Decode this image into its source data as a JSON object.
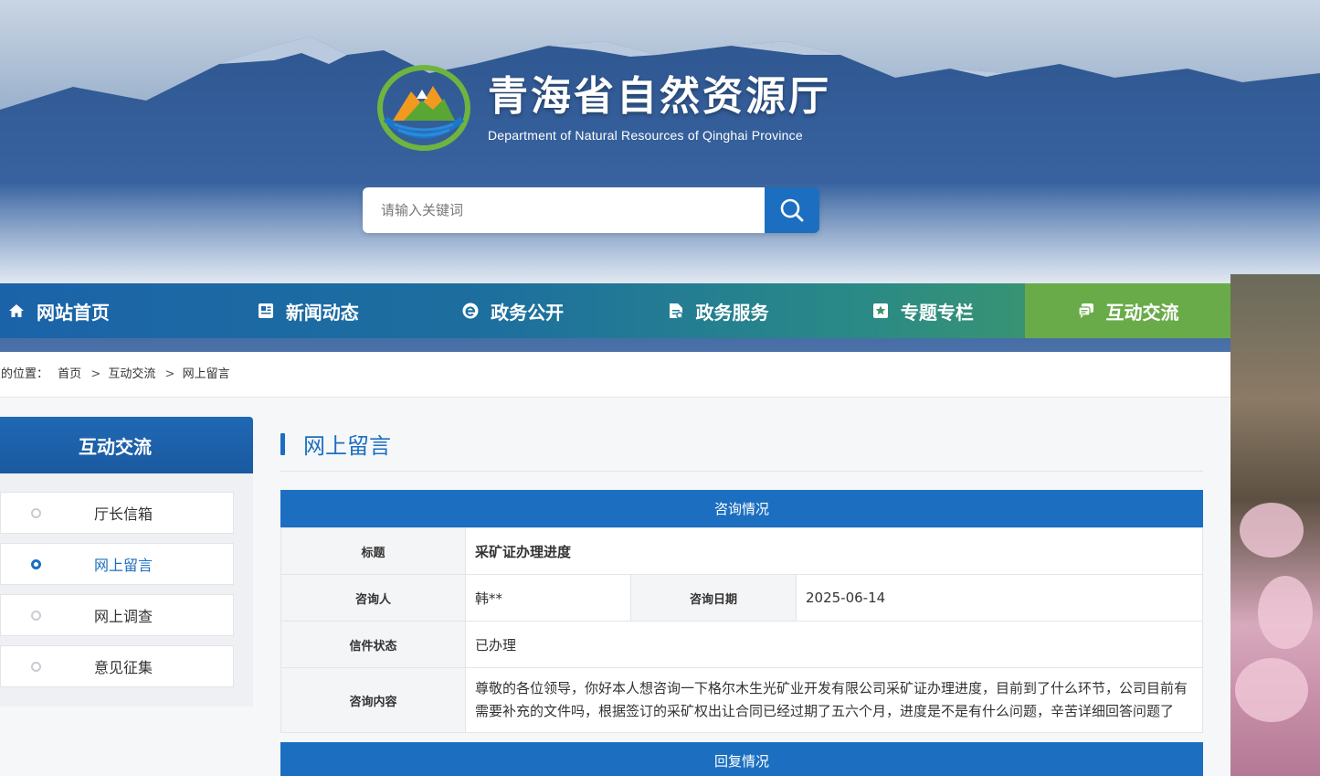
{
  "site": {
    "name_cn": "青海省自然资源厅",
    "name_en": "Department  of Natural Resources of Qinghai Province"
  },
  "search": {
    "placeholder": "请输入关键词",
    "icon": "search-icon"
  },
  "nav": {
    "items": [
      {
        "label": "网站首页",
        "icon": "home-icon"
      },
      {
        "label": "新闻动态",
        "icon": "news-icon"
      },
      {
        "label": "政务公开",
        "icon": "e-icon"
      },
      {
        "label": "政务服务",
        "icon": "document-icon"
      },
      {
        "label": "专题专栏",
        "icon": "star-icon"
      },
      {
        "label": "互动交流",
        "icon": "chat-icon",
        "active": true
      }
    ]
  },
  "breadcrumb": {
    "prefix": "您的位置：",
    "items": [
      "首页",
      "互动交流",
      "网上留言"
    ],
    "separator": ">"
  },
  "sidebar": {
    "title": "互动交流",
    "items": [
      {
        "label": "厅长信箱"
      },
      {
        "label": "网上留言",
        "active": true
      },
      {
        "label": "网上调查"
      },
      {
        "label": "意见征集"
      }
    ]
  },
  "main": {
    "title": "网上留言",
    "consult_section": "咨询情况",
    "reply_section": "回复情况",
    "fields": {
      "title_label": "标题",
      "title_value": "采矿证办理进度",
      "person_label": "咨询人",
      "person_value": "韩**",
      "date_label": "咨询日期",
      "date_value": "2025-06-14",
      "status_label": "信件状态",
      "status_value": "已办理",
      "content_label": "咨询内容",
      "content_value": "尊敬的各位领导，你好本人想咨询一下格尔木生光矿业开发有限公司采矿证办理进度，目前到了什么环节，公司目前有需要补充的文件吗，根据签订的采矿权出让合同已经过期了五六个月，进度是不是有什么问题，辛苦详细回答问题了"
    }
  },
  "colors": {
    "primary": "#1c6fc0",
    "nav_active": "#6aab49"
  }
}
